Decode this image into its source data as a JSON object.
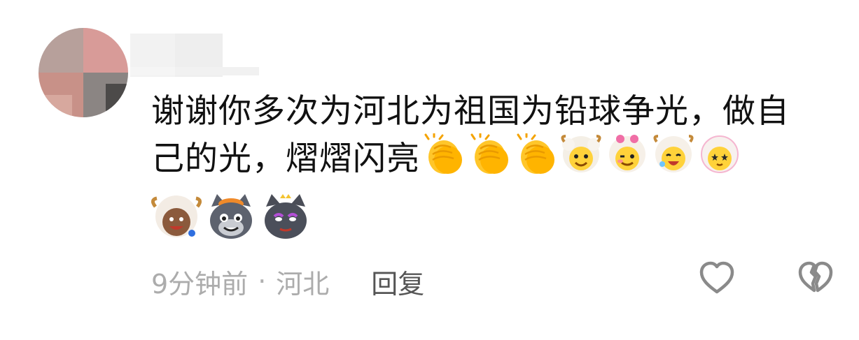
{
  "comment": {
    "text_line1": "谢谢你多次为河北为祖国为铅球争光，做自",
    "text_line2": "己的光，熠熠闪亮",
    "time": "9分钟前",
    "separator": "·",
    "location": "河北",
    "reply_label": "回复"
  },
  "emojis": {
    "inline": [
      "clap-emoji",
      "clap-emoji",
      "clap-emoji",
      "sheep-happy-emoji",
      "sheep-wink-emoji",
      "sheep-laugh-emoji",
      "sheep-star-eyes-emoji"
    ],
    "row2": [
      "sheep-brown-emoji",
      "wolf-grey-emoji",
      "wolf-red-emoji"
    ]
  },
  "icons": {
    "like": "heart-outline-icon",
    "dislike": "broken-heart-icon"
  },
  "colors": {
    "text": "#111111",
    "meta": "#acacac",
    "reply": "#555555",
    "icon": "#8a8a8a"
  }
}
